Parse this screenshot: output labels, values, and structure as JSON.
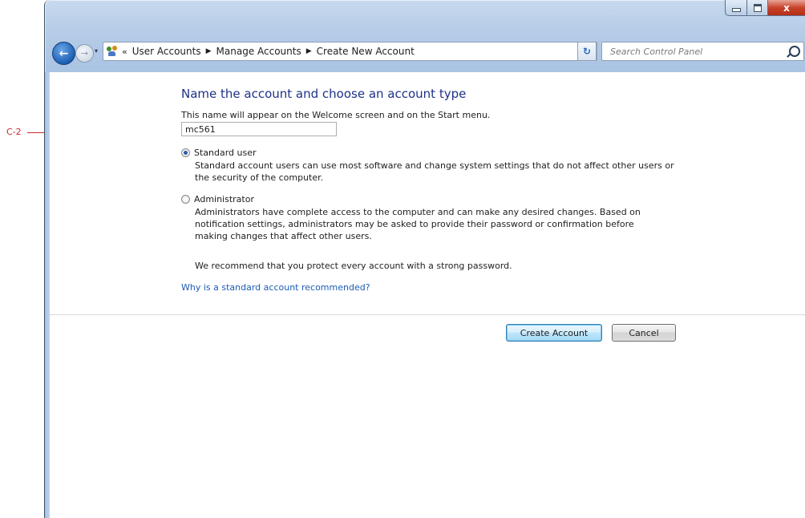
{
  "callout": {
    "label": "C-2"
  },
  "titlebar": {
    "minimize_icon": "minimize-icon",
    "maximize_icon": "maximize-icon",
    "close_label": "x"
  },
  "navigation": {
    "back_glyph": "←",
    "forward_glyph": "→",
    "recent_glyph": "▾",
    "breadcrumbs": [
      "User Accounts",
      "Manage Accounts",
      "Create New Account"
    ],
    "breadcrumb_prefix": "«",
    "separator": "▶",
    "dropdown_glyph": "▾",
    "refresh_glyph": "↻"
  },
  "search": {
    "placeholder": "Search Control Panel"
  },
  "form": {
    "heading": "Name the account and choose an account type",
    "description": "This name will appear on the Welcome screen and on the Start menu.",
    "account_name": "mc561",
    "options": [
      {
        "label": "Standard user",
        "selected": true,
        "description_lines": [
          "Standard account users can use most software and change system settings that do not affect other users or",
          "the security of the computer."
        ]
      },
      {
        "label": "Administrator",
        "selected": false,
        "description_lines": [
          "Administrators have complete access to the computer and can make any desired changes. Based on",
          "notification settings, administrators may be asked to provide their password or confirmation before",
          "making changes that affect other users."
        ]
      }
    ],
    "recommendation": "We recommend that you protect every account with a strong password.",
    "help_link": "Why is a standard account recommended?"
  },
  "buttons": {
    "create": "Create Account",
    "cancel": "Cancel"
  }
}
